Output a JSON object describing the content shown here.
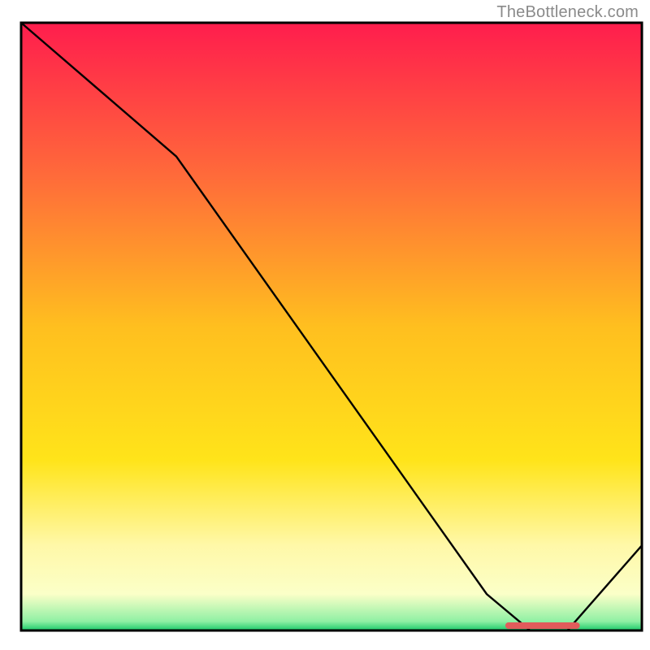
{
  "attribution": "TheBottleneck.com",
  "chart_data": {
    "type": "line",
    "title": "",
    "xlabel": "",
    "ylabel": "",
    "xlim": [
      0,
      100
    ],
    "ylim": [
      0,
      100
    ],
    "x": [
      0,
      25,
      75,
      82,
      88,
      100
    ],
    "values": [
      100,
      78,
      6,
      0,
      0,
      14
    ],
    "optimal_marker": {
      "x_start": 78,
      "x_end": 90,
      "color": "#e15b5b"
    },
    "background_gradient": {
      "stops": [
        {
          "offset": 0.0,
          "color": "#ff1d4d"
        },
        {
          "offset": 0.25,
          "color": "#ff6a3a"
        },
        {
          "offset": 0.5,
          "color": "#ffbf1f"
        },
        {
          "offset": 0.72,
          "color": "#ffe41a"
        },
        {
          "offset": 0.86,
          "color": "#fff8a8"
        },
        {
          "offset": 0.94,
          "color": "#fbffc8"
        },
        {
          "offset": 0.985,
          "color": "#8ff0a4"
        },
        {
          "offset": 1.0,
          "color": "#19c96a"
        }
      ]
    }
  }
}
